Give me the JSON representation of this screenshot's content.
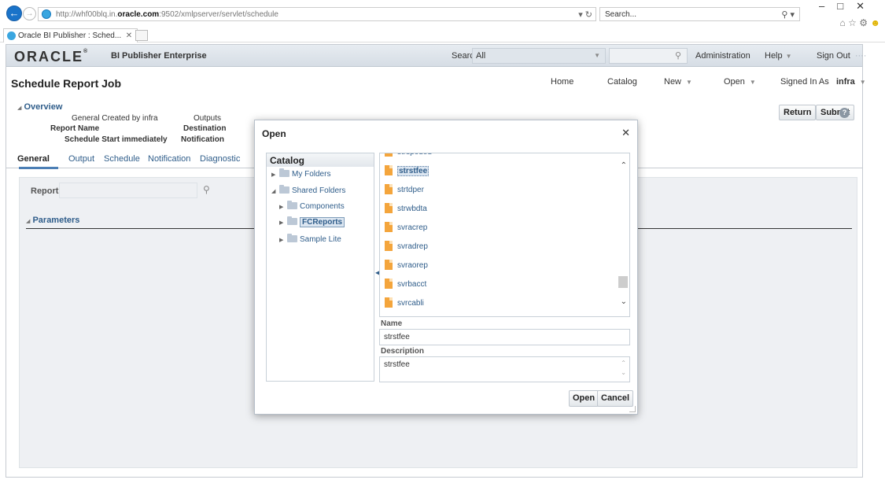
{
  "browser": {
    "url_prefix": "http://whf00blq.in.",
    "url_domain": "oracle.com",
    "url_suffix": ":9502/xmlpserver/servlet/schedule",
    "search_placeholder": "Search...",
    "tab_title": "Oracle BI Publisher : Sched...",
    "refresh_icon": "refresh-icon"
  },
  "brand": {
    "logo_text": "ORACLE",
    "product": "BI Publisher Enterprise",
    "search_label": "Search",
    "search_scope": "All",
    "links": [
      "Administration",
      "Help",
      "Sign Out"
    ]
  },
  "header": {
    "title": "Schedule Report Job",
    "nav": [
      "Home",
      "Catalog",
      "New",
      "Open"
    ],
    "signed_in_label": "Signed In As",
    "signed_in_user": "infra"
  },
  "overview": {
    "title": "Overview",
    "general": "General",
    "created_by": "Created by infra",
    "report_name": "Report Name",
    "schedule_start_label": "Schedule Start",
    "schedule_start_value": "immediately",
    "outputs": "Outputs",
    "destination": "Destination",
    "notification": "Notification",
    "return_label": "Return",
    "submit_label": "Submit"
  },
  "tabs": [
    "General",
    "Output",
    "Schedule",
    "Notification",
    "Diagnostic"
  ],
  "content": {
    "report_label": "Report",
    "parameters_label": "Parameters"
  },
  "dialog": {
    "title": "Open",
    "catalog_title": "Catalog",
    "tree": [
      "My Folders",
      "Shared Folders",
      "Components",
      "FCReports",
      "Sample Lite"
    ],
    "partial_item": "strspoded",
    "files": [
      "strstfee",
      "strtdper",
      "strwbdta",
      "svracrep",
      "svradrep",
      "svraorep",
      "svrbacct",
      "svrcabli"
    ],
    "name_label": "Name",
    "name_value": "strstfee",
    "description_label": "Description",
    "description_value": "strstfee",
    "open_label": "Open",
    "cancel_label": "Cancel"
  }
}
